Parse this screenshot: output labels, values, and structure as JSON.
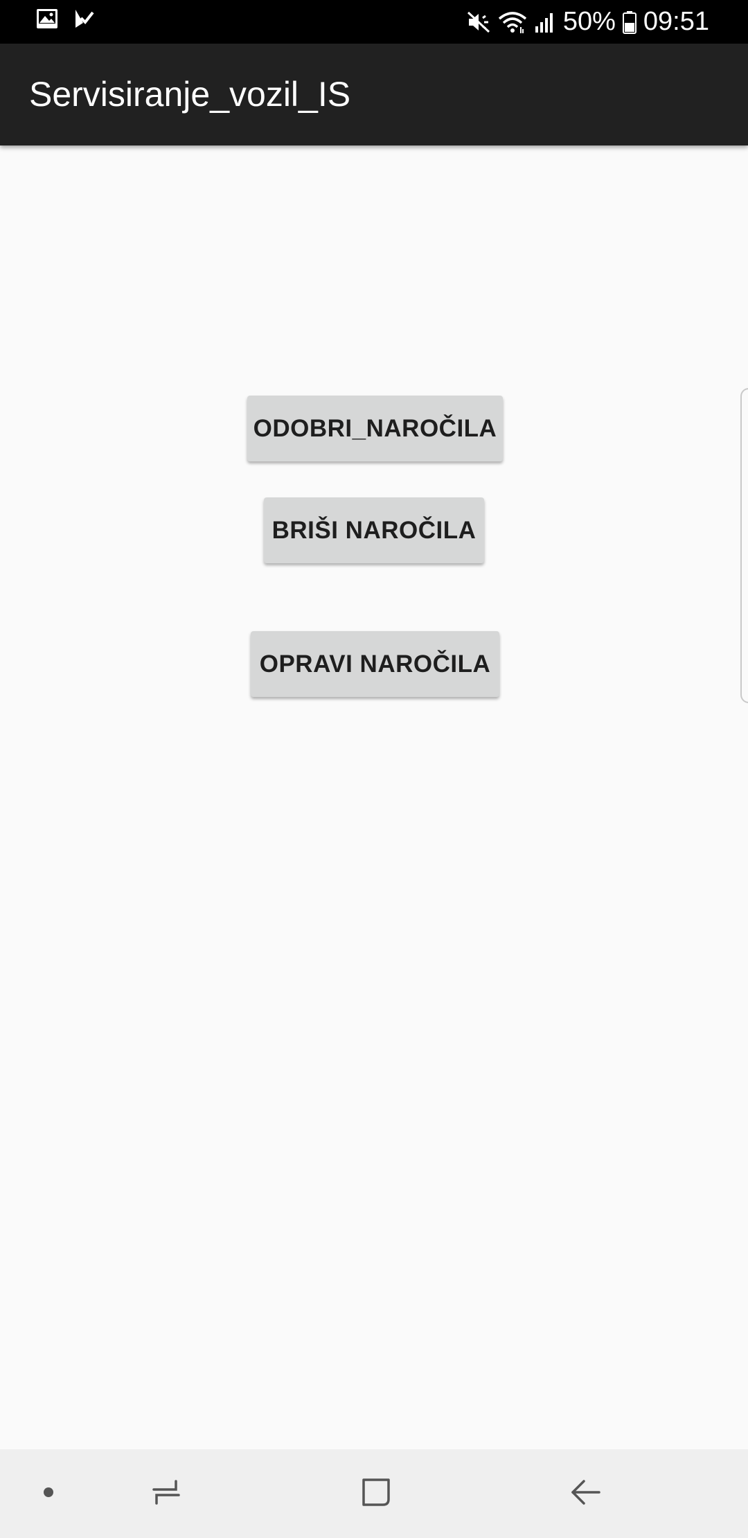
{
  "status_bar": {
    "left_icons": [
      "image-notification-icon",
      "task-check-notification-icon"
    ],
    "right_icons": [
      "mute-vibrate-icon",
      "wifi-icon",
      "signal-icon",
      "battery-icon"
    ],
    "battery_percent": "50%",
    "time": "09:51"
  },
  "app_bar": {
    "title": "Servisiranje_vozil_IS"
  },
  "buttons": {
    "odobri": "ODOBRI_NAROČILA",
    "brisi": "BRIŠI NAROČILA",
    "opravi": "OPRAVI NAROČILA"
  },
  "nav_bar": {
    "icons": [
      "dot-icon",
      "recent-apps-icon",
      "home-icon",
      "back-icon"
    ]
  },
  "colors": {
    "status_bar": "#000000",
    "app_bar": "#212121",
    "background": "#fafafa",
    "button": "#d6d7d7",
    "nav_bar": "#efefef"
  }
}
